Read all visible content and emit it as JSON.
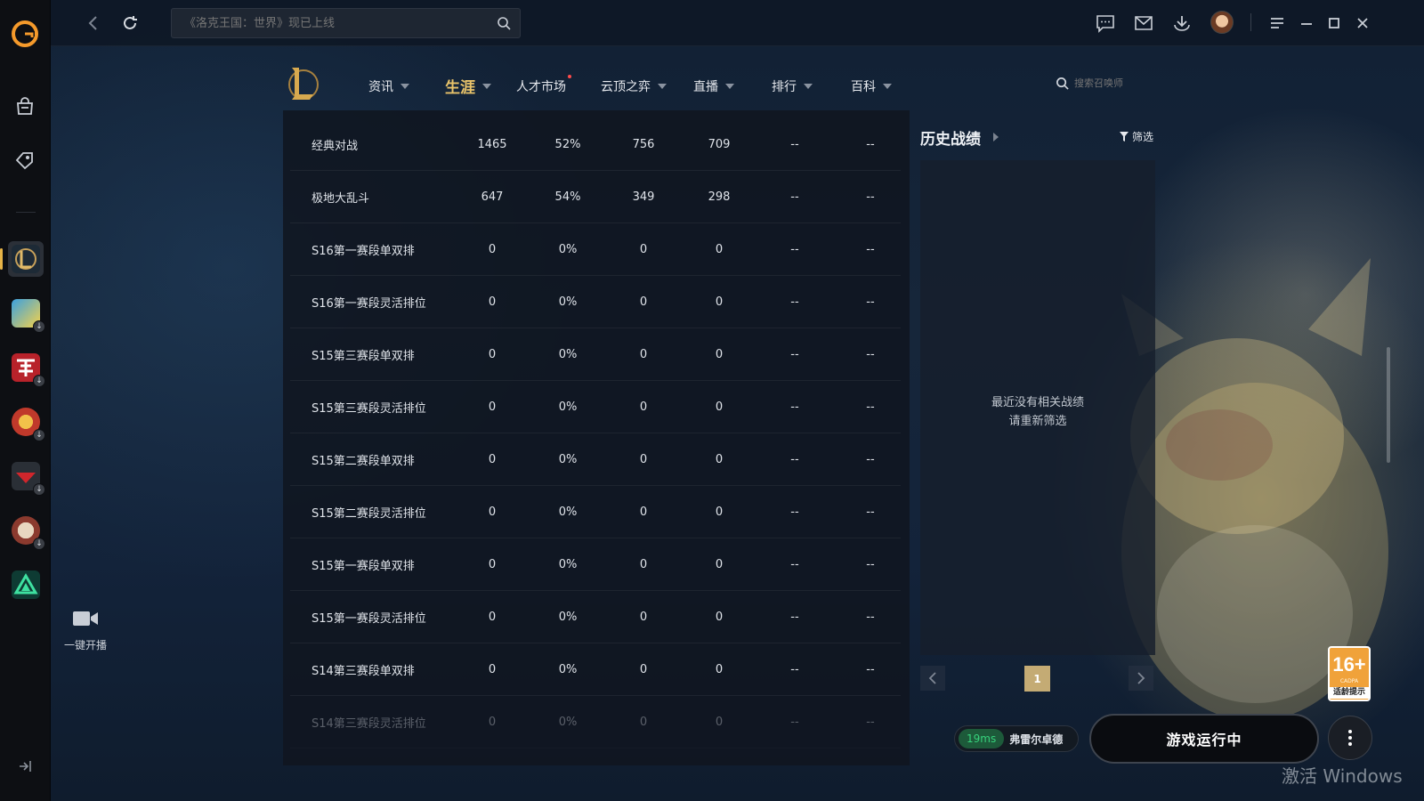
{
  "topbar": {
    "search_placeholder": "《洛克王国：世界》现已上线"
  },
  "lol_nav": [
    {
      "label": "资讯",
      "caret": true
    },
    {
      "label": "生涯",
      "caret": true,
      "active": true
    },
    {
      "label": "人才市场",
      "caret": false,
      "dot": true
    },
    {
      "label": "云顶之弈",
      "caret": true
    },
    {
      "label": "直播",
      "caret": true
    },
    {
      "label": "排行",
      "caret": true
    },
    {
      "label": "百科",
      "caret": true
    }
  ],
  "lol_search_placeholder": "搜索召唤师",
  "stats_rows": [
    {
      "name": "经典对战",
      "c1": "1465",
      "c2": "52%",
      "c3": "756",
      "c4": "709",
      "c5": "--",
      "c6": "--"
    },
    {
      "name": "极地大乱斗",
      "c1": "647",
      "c2": "54%",
      "c3": "349",
      "c4": "298",
      "c5": "--",
      "c6": "--"
    },
    {
      "name": "S16第一赛段单双排",
      "c1": "0",
      "c2": "0%",
      "c3": "0",
      "c4": "0",
      "c5": "--",
      "c6": "--"
    },
    {
      "name": "S16第一赛段灵活排位",
      "c1": "0",
      "c2": "0%",
      "c3": "0",
      "c4": "0",
      "c5": "--",
      "c6": "--"
    },
    {
      "name": "S15第三赛段单双排",
      "c1": "0",
      "c2": "0%",
      "c3": "0",
      "c4": "0",
      "c5": "--",
      "c6": "--"
    },
    {
      "name": "S15第三赛段灵活排位",
      "c1": "0",
      "c2": "0%",
      "c3": "0",
      "c4": "0",
      "c5": "--",
      "c6": "--"
    },
    {
      "name": "S15第二赛段单双排",
      "c1": "0",
      "c2": "0%",
      "c3": "0",
      "c4": "0",
      "c5": "--",
      "c6": "--"
    },
    {
      "name": "S15第二赛段灵活排位",
      "c1": "0",
      "c2": "0%",
      "c3": "0",
      "c4": "0",
      "c5": "--",
      "c6": "--"
    },
    {
      "name": "S15第一赛段单双排",
      "c1": "0",
      "c2": "0%",
      "c3": "0",
      "c4": "0",
      "c5": "--",
      "c6": "--"
    },
    {
      "name": "S15第一赛段灵活排位",
      "c1": "0",
      "c2": "0%",
      "c3": "0",
      "c4": "0",
      "c5": "--",
      "c6": "--"
    },
    {
      "name": "S14第三赛段单双排",
      "c1": "0",
      "c2": "0%",
      "c3": "0",
      "c4": "0",
      "c5": "--",
      "c6": "--"
    },
    {
      "name": "S14第三赛段灵活排位",
      "c1": "0",
      "c2": "0%",
      "c3": "0",
      "c4": "0",
      "c5": "--",
      "c6": "--"
    }
  ],
  "history": {
    "title": "历史战绩",
    "filter_label": "筛选",
    "empty_line1": "最近没有相关战绩",
    "empty_line2": "请重新筛选",
    "current_page": "1"
  },
  "live": {
    "label": "一键开播"
  },
  "launch": {
    "ping": "19ms",
    "server": "弗雷尔卓德",
    "button_label": "游戏运行中"
  },
  "age_rating": {
    "number": "16+",
    "cadpa": "CADPA",
    "tip": "适龄提示"
  },
  "watermark": "激活 Windows",
  "colors": {
    "accent_gold": "#e9c36a",
    "ping_green": "#37d27c",
    "page_active": "#c4ab74"
  }
}
